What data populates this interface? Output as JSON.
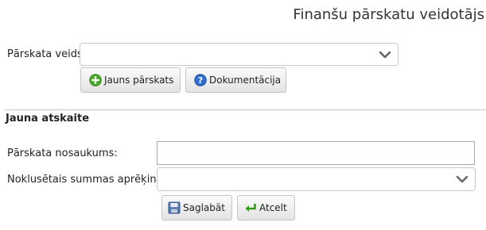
{
  "header": {
    "title": "Finanšu pārskatu veidotājs"
  },
  "report_type": {
    "label": "Pārskata veids:",
    "selected_value": "",
    "dropdown_icon": "chevron-down-icon"
  },
  "toolbar": {
    "new_report_label": "Jauns pārskats",
    "new_report_icon": "plus-circle-icon",
    "docs_label": "Dokumentācija",
    "docs_icon": "help-icon"
  },
  "new_report_form": {
    "section_title": "Jauna atskaite",
    "name_label": "Pārskata nosaukums:",
    "name_value": "",
    "default_sum_label": "Noklusētais summas aprēķins:",
    "default_sum_value": "",
    "save_label": "Saglabāt",
    "save_icon": "save-icon",
    "cancel_label": "Atcelt",
    "cancel_icon": "undo-arrow-icon"
  },
  "colors": {
    "accent_green": "#4caf2a",
    "accent_blue": "#2f6fd1",
    "border": "#c9c9c9"
  }
}
